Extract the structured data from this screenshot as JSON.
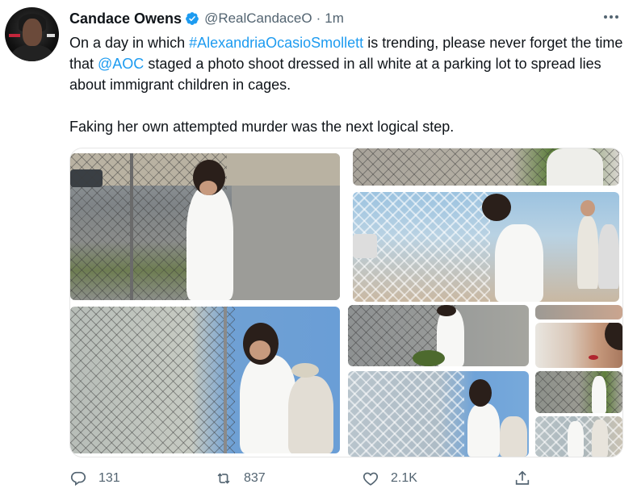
{
  "author": {
    "name": "Candace Owens",
    "handle": "@RealCandaceO",
    "time": "1m",
    "verified": true
  },
  "tweet": {
    "line1_pre": "On a day in which ",
    "hashtag": "#AlexandriaOcasioSmollett",
    "line1_post": " is trending, please never forget the time that ",
    "mention": "@AOC",
    "line1_end": " staged a photo shoot dressed in all white at a parking lot to spread lies about immigrant children in cages.",
    "line2": "Faking her own attempted murder was the next logical step."
  },
  "actions": {
    "replies": "131",
    "retweets": "837",
    "likes": "2.1K"
  },
  "colors": {
    "link": "#1d9bf0",
    "verified": "#1d9bf0",
    "muted": "#536471"
  }
}
